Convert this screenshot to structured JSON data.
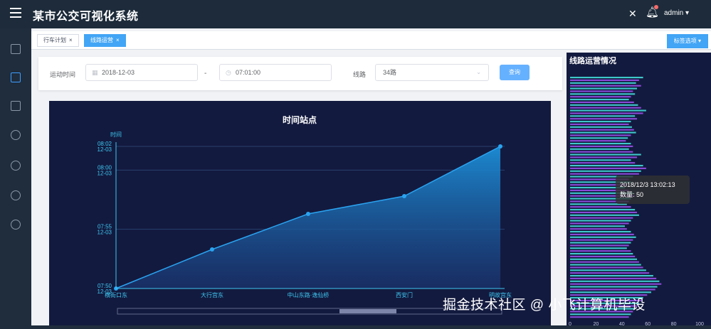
{
  "header": {
    "title": "某市公交可视化系统",
    "user": "admin",
    "user_arrow": "▾",
    "icons": [
      "menu-icon",
      "fullscreen-icon",
      "bell-icon",
      "user-dropdown-icon"
    ]
  },
  "sidebar": {
    "icons": [
      "home-icon",
      "dashboard-icon",
      "database-icon",
      "smile-icon",
      "clock-icon",
      "globe-icon",
      "globe-icon"
    ]
  },
  "tabs": [
    {
      "label": "行车计划",
      "close": "×",
      "active": false
    },
    {
      "label": "线路运营",
      "close": "×",
      "active": true
    }
  ],
  "tab_options": "标签选项",
  "filter": {
    "time_label": "运动时间",
    "date_value": "2018-12-03",
    "dash": "-",
    "time_value": "07:01:00",
    "line_label": "线路",
    "line_value": "34路",
    "query_button": "查询"
  },
  "chart_data": [
    {
      "type": "area",
      "title": "时间站点",
      "ylabel": "时间",
      "categories": [
        "横街口东",
        "大行宫东",
        "中山东路·逸仙桥",
        "西安门",
        "明故宫东"
      ],
      "y_tick_labels": [
        [
          "07:50",
          "12-03"
        ],
        [
          "07:55",
          "12-03"
        ],
        [
          "08:00",
          "12-03"
        ],
        [
          "08:02",
          "12-03"
        ]
      ],
      "y_ticks_minutes": [
        470,
        475,
        480,
        482
      ],
      "values_minutes": [
        470,
        473.3,
        476.3,
        477.8,
        482
      ],
      "ylim": [
        470,
        482
      ],
      "color": "#1c8fd8",
      "scroll_bar": true
    },
    {
      "type": "bar",
      "orientation": "horizontal",
      "title": "线路运营情况",
      "x_ticks": [
        0,
        20,
        40,
        60,
        80,
        100
      ],
      "xlim": [
        0,
        100
      ],
      "bar_colors": [
        "#3ec7c9",
        "#8a49d8"
      ],
      "values": [
        72,
        68,
        65,
        70,
        66,
        62,
        64,
        60,
        58,
        63,
        67,
        70,
        75,
        72,
        64,
        66,
        60,
        58,
        61,
        63,
        65,
        60,
        57,
        55,
        60,
        62,
        58,
        62,
        70,
        66,
        60,
        64,
        72,
        75,
        70,
        68,
        62,
        58,
        60,
        56,
        54,
        58,
        62,
        64,
        60,
        58,
        56,
        60,
        64,
        66,
        68,
        62,
        60,
        58,
        54,
        56,
        60,
        63,
        65,
        62,
        60,
        58,
        56,
        60,
        62,
        64,
        66,
        68,
        70,
        72,
        75,
        78,
        82,
        85,
        88,
        90,
        86,
        84,
        80,
        76,
        72,
        70,
        68,
        66,
        64,
        62,
        60,
        58
      ],
      "tooltip": {
        "time": "2018/12/3 13:02:13",
        "label": "数量: 50"
      }
    }
  ],
  "watermark": "掘金技术社区 @ 小飞计算机毕设"
}
